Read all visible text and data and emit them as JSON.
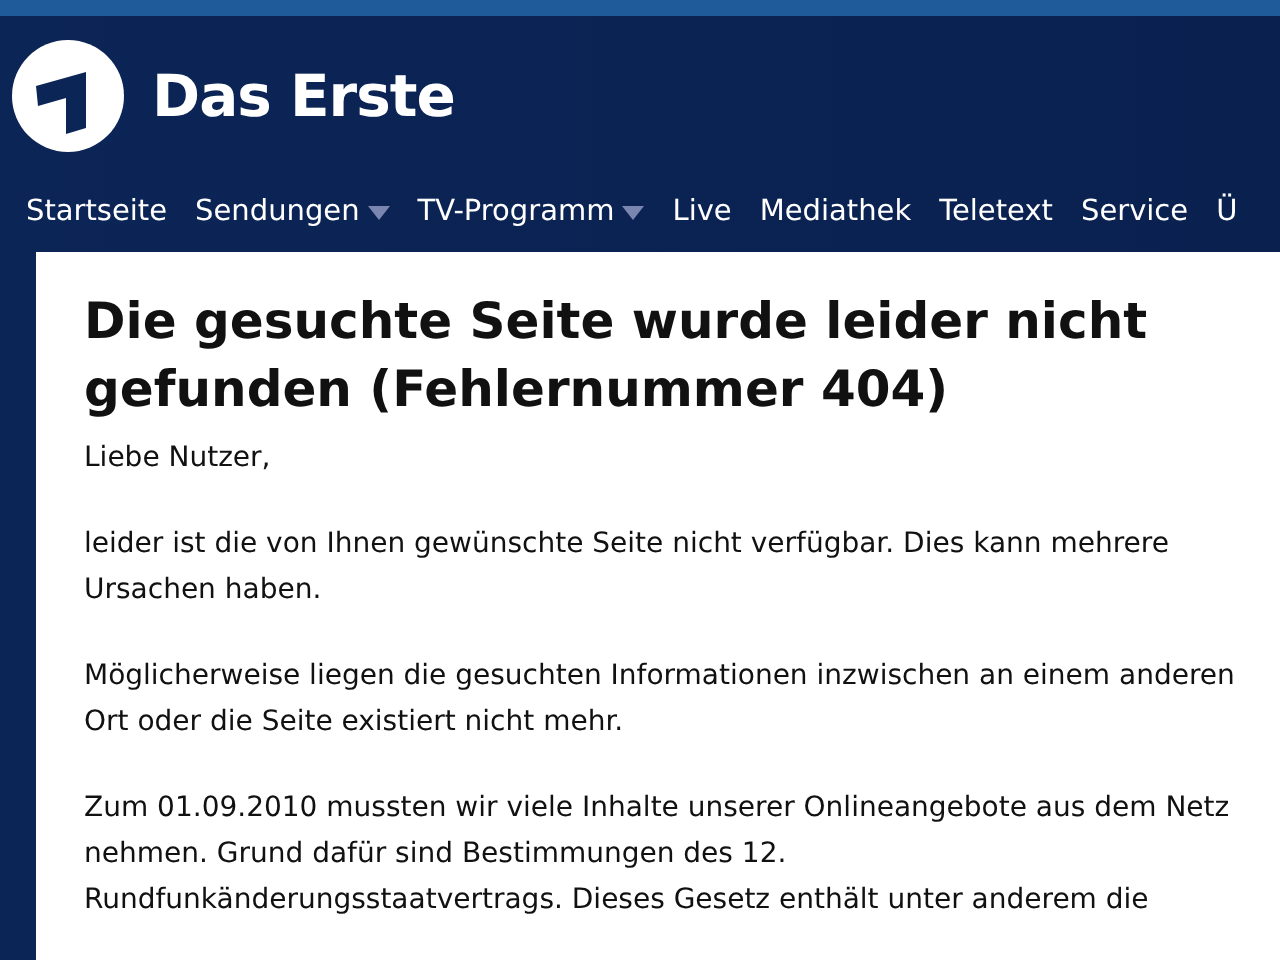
{
  "header": {
    "site_name": "Das Erste"
  },
  "nav": [
    {
      "label": "Startseite",
      "has_menu": false
    },
    {
      "label": "Sendungen",
      "has_menu": true
    },
    {
      "label": "TV-Programm",
      "has_menu": true
    },
    {
      "label": "Live",
      "has_menu": false
    },
    {
      "label": "Mediathek",
      "has_menu": false
    },
    {
      "label": "Teletext",
      "has_menu": false
    },
    {
      "label": "Service",
      "has_menu": false
    },
    {
      "label": "Ü",
      "has_menu": false
    }
  ],
  "content": {
    "heading": "Die gesuchte Seite wurde leider nicht gefunden (Fehlernummer 404)",
    "paragraphs": [
      "Liebe Nutzer,",
      "leider ist die von Ihnen gewünschte Seite nicht verfügbar. Dies kann mehrere Ursachen haben.",
      "Möglicherweise liegen die gesuchten Informationen inzwischen an einem anderen Ort oder die Seite existiert nicht mehr.",
      "Zum 01.09.2010 mussten wir viele Inhalte unserer Onlineangebote aus dem Netz nehmen. Grund dafür sind Bestimmungen des 12. Rundfunkänderungsstaatvertrags. Dieses Gesetz enthält unter anderem die"
    ]
  }
}
